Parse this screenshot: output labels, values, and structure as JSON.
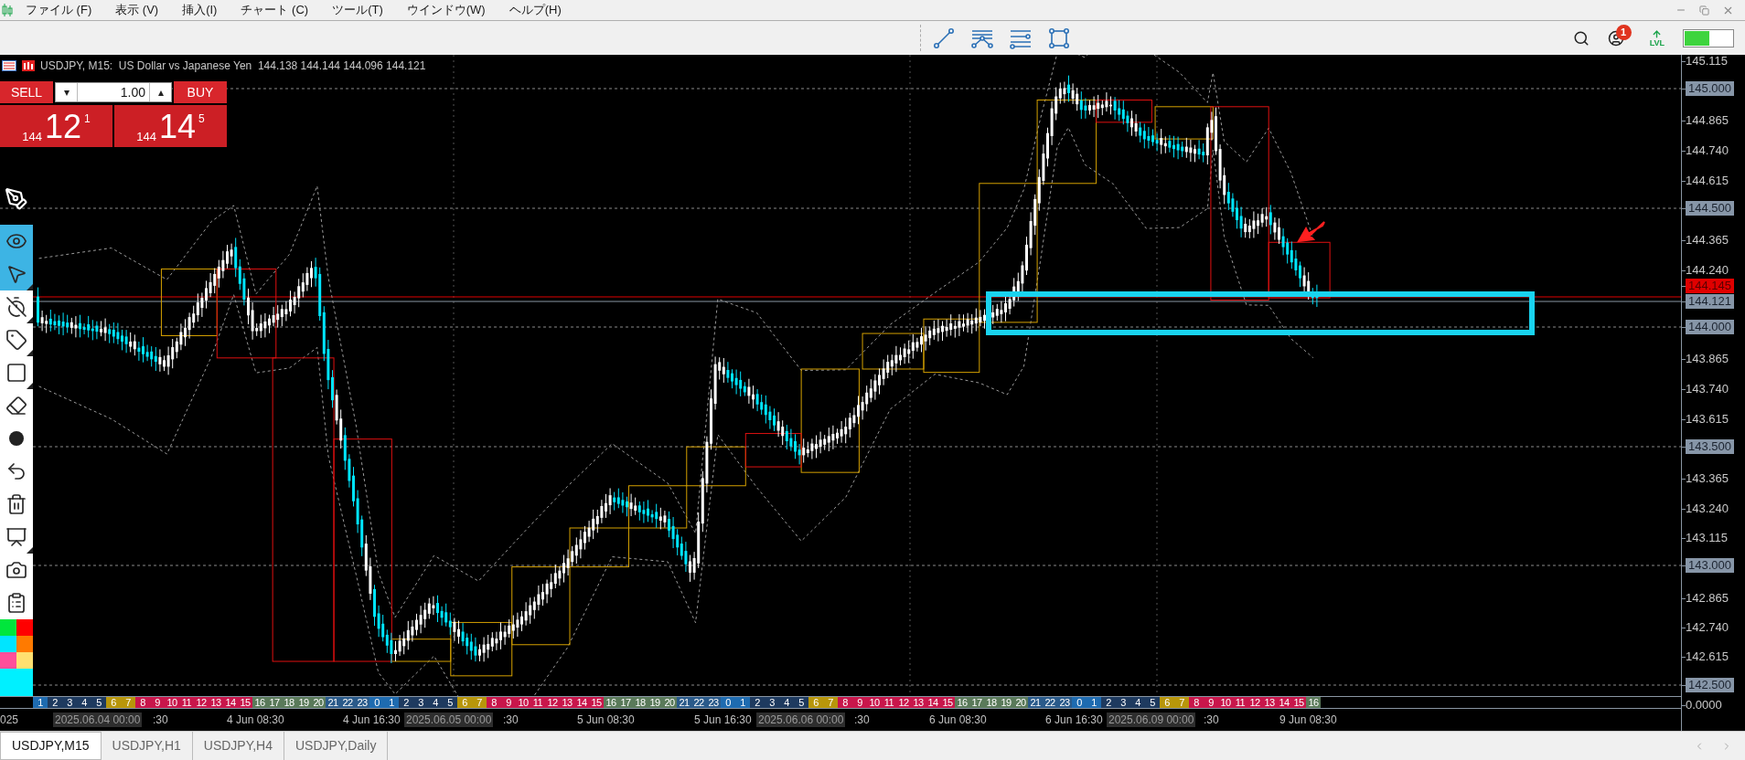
{
  "menu_bar": {
    "items": [
      "ファイル (F)",
      "表示 (V)",
      "挿入(I)",
      "チャート (C)",
      "ツール(T)",
      "ウインドウ(W)",
      "ヘルプ(H)"
    ]
  },
  "toolbar": {
    "notification_count": "1",
    "level_label": "LVL"
  },
  "chart": {
    "header": "USDJPY, M15:  US Dollar vs Japanese Yen  144.138 144.144 144.096 144.121",
    "trade_panel": {
      "sell_label": "SELL",
      "buy_label": "BUY",
      "volume": "1.00",
      "down_arrow": "▾",
      "up_arrow": "▴",
      "sell_price": {
        "head": "144",
        "main": "12",
        "tail": "1"
      },
      "buy_price": {
        "head": "144",
        "main": "14",
        "tail": "5"
      }
    },
    "drawing_tools": [
      {
        "selected": true
      },
      {
        "selected": true
      },
      {
        "selected": false
      },
      {
        "selected": false
      },
      {
        "selected": false
      },
      {
        "selected": false
      },
      {
        "selected": false
      },
      {
        "selected": false
      },
      {
        "selected": false
      },
      {
        "selected": false
      },
      {
        "selected": false
      },
      {
        "selected": false
      }
    ],
    "color_swatches": [
      {
        "color": "#00e63c"
      },
      {
        "color": "#ff0000"
      },
      {
        "color": "#00e5ff"
      },
      {
        "color": "#ff7a00"
      },
      {
        "color": "#ff4f9a"
      },
      {
        "color": "#ffe070"
      }
    ],
    "price_axis": [
      {
        "label": "145.115",
        "kind": "plain"
      },
      {
        "label": "145.000",
        "kind": "boxed"
      },
      {
        "label": "144.865",
        "kind": "plain"
      },
      {
        "label": "144.740",
        "kind": "plain"
      },
      {
        "label": "144.615",
        "kind": "plain"
      },
      {
        "label": "144.500",
        "kind": "boxed"
      },
      {
        "label": "144.365",
        "kind": "plain"
      },
      {
        "label": "144.240",
        "kind": "plain"
      },
      {
        "label": "144.145",
        "kind": "bid"
      },
      {
        "label": "144.121",
        "kind": "boxed"
      },
      {
        "label": "144.000",
        "kind": "boxed"
      },
      {
        "label": "143.865",
        "kind": "plain"
      },
      {
        "label": "143.740",
        "kind": "plain"
      },
      {
        "label": "143.615",
        "kind": "plain"
      },
      {
        "label": "143.500",
        "kind": "boxed"
      },
      {
        "label": "143.365",
        "kind": "plain"
      },
      {
        "label": "143.240",
        "kind": "plain"
      },
      {
        "label": "143.115",
        "kind": "plain"
      },
      {
        "label": "143.000",
        "kind": "boxed"
      },
      {
        "label": "142.865",
        "kind": "plain"
      },
      {
        "label": "142.740",
        "kind": "plain"
      },
      {
        "label": "142.615",
        "kind": "plain"
      },
      {
        "label": "142.500",
        "kind": "boxed"
      },
      {
        "label": "0.0000",
        "kind": "plain"
      }
    ],
    "hour_band": [
      {
        "color": "#1e6bb0",
        "hours": [
          "1"
        ]
      },
      {
        "color": "#1e3a5f",
        "hours": [
          "2",
          "3",
          "4",
          "5"
        ]
      },
      {
        "color": "#b8960a",
        "hours": [
          "6",
          "7"
        ]
      },
      {
        "color": "#c8164b",
        "hours": [
          "8",
          "9",
          "10",
          "11",
          "12",
          "13",
          "14",
          "15"
        ]
      },
      {
        "color": "#5a7a5a",
        "hours": [
          "16",
          "17",
          "18",
          "19",
          "20"
        ]
      },
      {
        "color": "#2a5a8a",
        "hours": [
          "21",
          "22",
          "23"
        ]
      },
      {
        "color": "#1e6bb0",
        "hours": [
          "0",
          "1"
        ]
      },
      {
        "color": "#1e3a5f",
        "hours": [
          "2",
          "3",
          "4",
          "5"
        ]
      },
      {
        "color": "#b8960a",
        "hours": [
          "6",
          "7"
        ]
      },
      {
        "color": "#c8164b",
        "hours": [
          "8",
          "9",
          "10",
          "11",
          "12",
          "13",
          "14",
          "15"
        ]
      },
      {
        "color": "#5a7a5a",
        "hours": [
          "16",
          "17",
          "18",
          "19",
          "20"
        ]
      },
      {
        "color": "#2a5a8a",
        "hours": [
          "21",
          "22",
          "23"
        ]
      },
      {
        "color": "#1e6bb0",
        "hours": [
          "0",
          "1"
        ]
      },
      {
        "color": "#1e3a5f",
        "hours": [
          "2",
          "3",
          "4",
          "5"
        ]
      },
      {
        "color": "#b8960a",
        "hours": [
          "6",
          "7"
        ]
      },
      {
        "color": "#c8164b",
        "hours": [
          "8",
          "9",
          "10",
          "11",
          "12",
          "13",
          "14",
          "15"
        ]
      },
      {
        "color": "#5a7a5a",
        "hours": [
          "16",
          "17",
          "18",
          "19",
          "20"
        ]
      },
      {
        "color": "#2a5a8a",
        "hours": [
          "21",
          "22",
          "23"
        ]
      },
      {
        "color": "#1e6bb0",
        "hours": [
          "0",
          "1"
        ]
      },
      {
        "color": "#1e3a5f",
        "hours": [
          "2",
          "3",
          "4",
          "5"
        ]
      },
      {
        "color": "#b8960a",
        "hours": [
          "6",
          "7"
        ]
      },
      {
        "color": "#c8164b",
        "hours": [
          "8",
          "9",
          "10",
          "11",
          "12",
          "13",
          "14",
          "15"
        ]
      },
      {
        "color": "#5a7a5a",
        "hours": [
          "16"
        ]
      }
    ],
    "time_axis": [
      {
        "label": "025",
        "kind": "plain"
      },
      {
        "label": "2025.06.04 00:00",
        "kind": "date"
      },
      {
        "label": ":30",
        "kind": "plain"
      },
      {
        "label": "4 Jun 08:30",
        "kind": "plain"
      },
      {
        "label": "4 Jun 16:30",
        "kind": "plain"
      },
      {
        "label": "2025.06.05 00:00",
        "kind": "date"
      },
      {
        "label": ":30",
        "kind": "plain"
      },
      {
        "label": "5 Jun 08:30",
        "kind": "plain"
      },
      {
        "label": "5 Jun 16:30",
        "kind": "plain"
      },
      {
        "label": "2025.06.06 00:00",
        "kind": "date"
      },
      {
        "label": ":30",
        "kind": "plain"
      },
      {
        "label": "6 Jun 08:30",
        "kind": "plain"
      },
      {
        "label": "6 Jun 16:30",
        "kind": "plain"
      },
      {
        "label": "2025.06.09 00:00",
        "kind": "date"
      },
      {
        "label": ":30",
        "kind": "plain"
      },
      {
        "label": "9 Jun 08:30",
        "kind": "plain"
      }
    ]
  },
  "tabs": [
    {
      "label": "USDJPY,M15",
      "selected": true
    },
    {
      "label": "USDJPY,H1",
      "selected": false
    },
    {
      "label": "USDJPY,H4",
      "selected": false
    },
    {
      "label": "USDJPY,Daily",
      "selected": false
    }
  ]
}
